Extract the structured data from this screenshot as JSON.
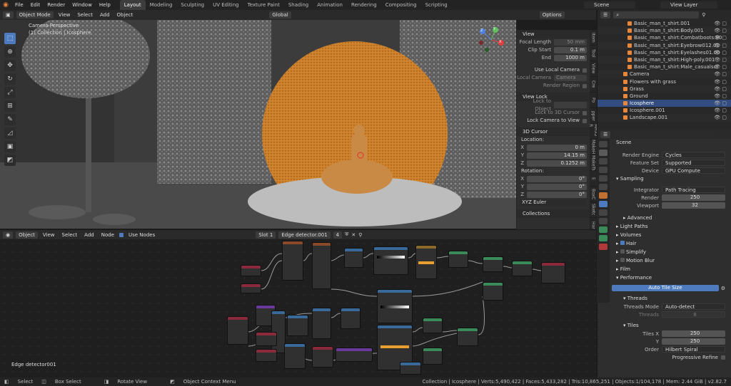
{
  "app": {
    "logo_icon": "blender-logo-icon"
  },
  "topbar": {
    "menus": [
      "File",
      "Edit",
      "Render",
      "Window",
      "Help"
    ],
    "workspaces": [
      "Layout",
      "Modeling",
      "Sculpting",
      "UV Editing",
      "Texture Paint",
      "Shading",
      "Animation",
      "Rendering",
      "Compositing",
      "Scripting"
    ],
    "active_workspace": "Layout",
    "scene": "Scene",
    "view_layer": "View Layer"
  },
  "viewport": {
    "mode": "Object Mode",
    "menus": [
      "View",
      "Select",
      "Add",
      "Object"
    ],
    "orientation": "Global",
    "options_label": "Options",
    "overlay_title": "Camera Perspective",
    "overlay_sub": "(1) Collection | Icosphere",
    "gizmo_axes": [
      "X",
      "Y",
      "Z"
    ]
  },
  "npanel": {
    "view_title": "View",
    "focal_length_label": "Focal Length",
    "focal_length": "50 mm",
    "clip_start_label": "Clip Start",
    "clip_start": "0.1 m",
    "end_label": "End",
    "end": "1000 m",
    "use_local_camera": "Use Local Camera",
    "local_camera_label": "Local Camera",
    "local_camera_value": "Camera",
    "render_region": "Render Region",
    "view_lock_title": "View Lock",
    "lock_to_object": "Lock to Object",
    "lock_3d_cursor": "Lock to 3D Cursor",
    "lock_camera_view": "Lock Camera to View",
    "cursor_title": "3D Cursor",
    "location_label": "Location:",
    "loc": [
      {
        "axis": "X",
        "val": "0 m"
      },
      {
        "axis": "Y",
        "val": "14.15 m"
      },
      {
        "axis": "Z",
        "val": "0.1252 m"
      }
    ],
    "rotation_label": "Rotation:",
    "rot": [
      {
        "axis": "X",
        "val": "0°"
      },
      {
        "axis": "Y",
        "val": "0°"
      },
      {
        "axis": "Z",
        "val": "0°"
      }
    ],
    "rot_mode": "XYZ Euler",
    "collections_title": "Collections",
    "tabs": [
      "Item",
      "Tool",
      "View",
      "Cre",
      "Po",
      "pper",
      "MHX2 R",
      "MakeH",
      "MakeTs",
      "E",
      "BoxC",
      "Sketc",
      "Har",
      "KIT"
    ]
  },
  "outliner": {
    "rows": [
      {
        "name": "Basic_man_t_shirt.001",
        "sel": false
      },
      {
        "name": "Basic_man_t_shirt:Body.001",
        "sel": false
      },
      {
        "name": "Basic_man_t_shirt:Combatboots.00",
        "sel": false
      },
      {
        "name": "Basic_man_t_shirt:Eyebrow012.00",
        "sel": false
      },
      {
        "name": "Basic_man_t_shirt:Eyelashes01.00",
        "sel": false
      },
      {
        "name": "Basic_man_t_shirt:High-poly.001",
        "sel": false
      },
      {
        "name": "Basic_man_t_shirt:Male_casualsui",
        "sel": false
      },
      {
        "name": "Camera",
        "sel": false
      },
      {
        "name": "Flowers with grass",
        "sel": false
      },
      {
        "name": "Grass",
        "sel": false
      },
      {
        "name": "Ground",
        "sel": false
      },
      {
        "name": "Icosphere",
        "sel": true
      },
      {
        "name": "Icosphere.001",
        "sel": false
      },
      {
        "name": "Landscape.001",
        "sel": false
      }
    ]
  },
  "properties": {
    "scene_name": "Scene",
    "render_engine_label": "Render Engine",
    "render_engine": "Cycles",
    "feature_set_label": "Feature Set",
    "feature_set": "Supported",
    "device_label": "Device",
    "device": "GPU Compute",
    "sampling": "Sampling",
    "integrator_label": "Integrator",
    "integrator": "Path Tracing",
    "render_label": "Render",
    "render_samples": "250",
    "viewport_label": "Viewport",
    "viewport_samples": "32",
    "advanced": "Advanced",
    "light_paths": "Light Paths",
    "volumes": "Volumes",
    "hair": "Hair",
    "simplify": "Simplify",
    "motion_blur": "Motion Blur",
    "film": "Film",
    "performance": "Performance",
    "auto_tile": "Auto Tile Size",
    "threads": "Threads",
    "threads_mode_label": "Threads Mode",
    "threads_mode": "Auto-detect",
    "threads_label": "Threads",
    "threads_val": "8",
    "tiles": "Tiles",
    "tiles_x_label": "Tiles X",
    "tiles_x": "250",
    "tiles_y_label": "Y",
    "tiles_y": "250",
    "order_label": "Order",
    "order": "Hilbert Spiral",
    "progressive_refine": "Progressive Refine"
  },
  "node_editor": {
    "type": "Object",
    "menus": [
      "View",
      "Select",
      "Add",
      "Node"
    ],
    "use_nodes": "Use Nodes",
    "slot": "Slot 1",
    "material": "Edge detector.001",
    "users": "4",
    "label": "Edge detector001"
  },
  "status": {
    "select": "Select",
    "box_select": "Box Select",
    "rotate": "Rotate View",
    "context": "Object Context Menu",
    "stats": "Collection | Icosphere | Verts:5,490,422 | Faces:5,433,282 | Tris:10,865,251 | Objects:1/104,178 | Mem: 2.44 GiB | v2.82.7"
  }
}
